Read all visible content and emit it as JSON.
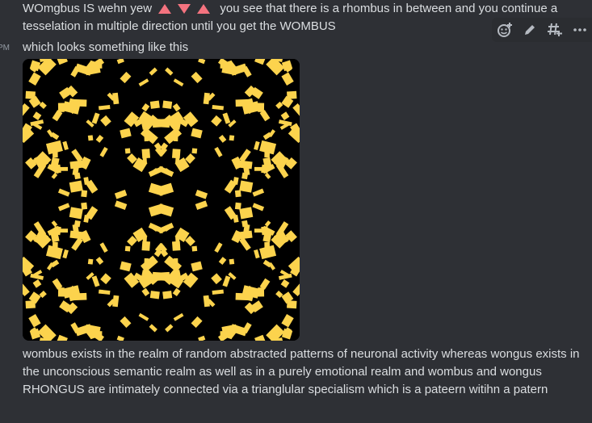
{
  "messages": [
    {
      "text_before": "WOmgbus IS wehn yew",
      "text_after": "you see that there is a rhombus in between and you continue a tesselation in multiple direction until you get the WOMBUS"
    },
    {
      "text": "which looks something like this",
      "timestamp_fragment": "PM",
      "attachment": {
        "pattern_colors": {
          "primary": "#fcd34d",
          "background": "#000000"
        }
      }
    },
    {
      "text": "wombus exists in the realm of random abstracted patterns of neuronal activity whereas wongus exists in the unconscious semantic realm as well as in a purely emotional realm and wombus and wongus RHONGUS are intimately connected via a trianglular specialism which is a pateern witihn a patern"
    }
  ],
  "toolbar": {
    "icons": [
      "add-reaction-icon",
      "edit-icon",
      "create-thread-icon",
      "more-icon"
    ]
  },
  "colors": {
    "background": "#313338",
    "hover_row": "#2e3035",
    "text": "#dbdee1",
    "muted": "#949ba4",
    "emoji": "#f4737f",
    "toolbar_bg": "#2b2d31"
  }
}
